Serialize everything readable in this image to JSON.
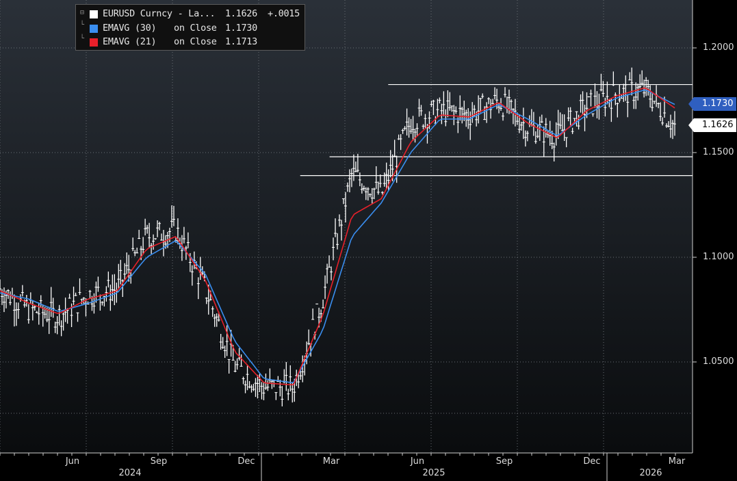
{
  "legend": {
    "rows": [
      {
        "name": "EURUSD Curncy - La...",
        "basis": "",
        "value": "1.1626",
        "change": "+.0015",
        "color": "#ffffff"
      },
      {
        "name": "EMAVG (30)",
        "basis": "on Close",
        "value": "1.1730",
        "change": "",
        "color": "#3a8ef0"
      },
      {
        "name": "EMAVG (21)",
        "basis": "on Close",
        "value": "1.1713",
        "change": "",
        "color": "#e8202a"
      }
    ]
  },
  "price_tags": {
    "ema30": "1.1730",
    "last": "1.1626"
  },
  "chart_data": {
    "type": "line",
    "title": "",
    "xlabel": "",
    "ylabel": "",
    "ylim": [
      1.02,
      1.21
    ],
    "grid": true,
    "legend_position": "top-left",
    "y_ticks": [
      "1.2000",
      "1.1500",
      "1.1000",
      "1.0500"
    ],
    "x_ticks": [
      "Jun",
      "Sep",
      "Dec",
      "Mar",
      "Jun",
      "Sep",
      "Dec",
      "Mar"
    ],
    "years": [
      "2024",
      "2025",
      "2026"
    ],
    "x": [
      "2024-04",
      "2024-05",
      "2024-06",
      "2024-07",
      "2024-08",
      "2024-09",
      "2024-10",
      "2024-11",
      "2024-12",
      "2025-01",
      "2025-02",
      "2025-03",
      "2025-04",
      "2025-05",
      "2025-06",
      "2025-07",
      "2025-08",
      "2025-09",
      "2025-10",
      "2025-11",
      "2025-12",
      "2026-01",
      "2026-02",
      "2026-03"
    ],
    "series": [
      {
        "name": "EURUSD Curncy - La...",
        "color": "#ffffff",
        "values": [
          1.085,
          1.075,
          1.072,
          1.082,
          1.085,
          1.11,
          1.113,
          1.085,
          1.048,
          1.038,
          1.038,
          1.08,
          1.14,
          1.13,
          1.165,
          1.17,
          1.168,
          1.175,
          1.162,
          1.158,
          1.172,
          1.178,
          1.18,
          1.1626
        ]
      },
      {
        "name": "EMAVG (30)",
        "color": "#3a8ef0",
        "values": [
          1.083,
          1.08,
          1.074,
          1.078,
          1.083,
          1.1,
          1.108,
          1.092,
          1.06,
          1.042,
          1.04,
          1.065,
          1.11,
          1.126,
          1.15,
          1.166,
          1.166,
          1.173,
          1.166,
          1.158,
          1.168,
          1.176,
          1.18,
          1.173
        ]
      },
      {
        "name": "EMAVG (21)",
        "color": "#e8202a",
        "values": [
          1.084,
          1.078,
          1.073,
          1.08,
          1.084,
          1.104,
          1.11,
          1.089,
          1.055,
          1.04,
          1.039,
          1.072,
          1.12,
          1.128,
          1.155,
          1.168,
          1.167,
          1.174,
          1.164,
          1.157,
          1.17,
          1.177,
          1.181,
          1.1713
        ]
      }
    ],
    "horizontal_levels": [
      {
        "y": 1.1825,
        "x_start": "2025-05",
        "x_end": "2026-03"
      },
      {
        "y": 1.148,
        "x_start": "2025-03",
        "x_end": "2026-03"
      },
      {
        "y": 1.139,
        "x_start": "2025-02",
        "x_end": "2026-03"
      }
    ]
  }
}
